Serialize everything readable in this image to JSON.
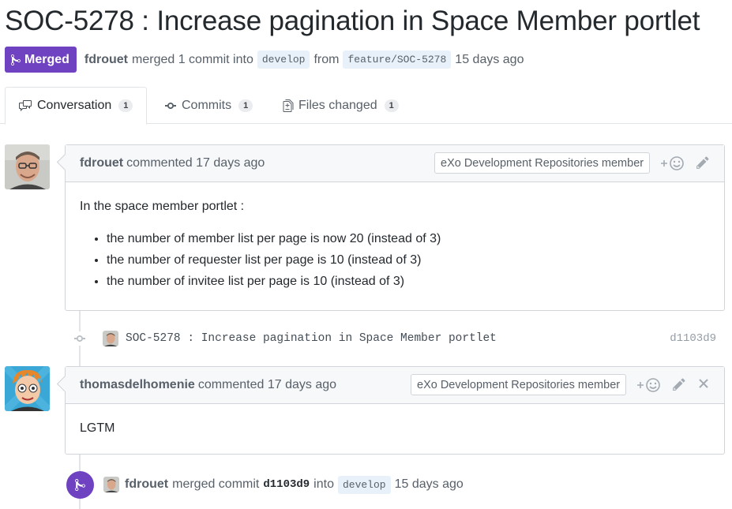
{
  "pr": {
    "title": "SOC-5278 : Increase pagination in Space Member portlet",
    "state": "Merged",
    "author": "fdrouet",
    "merged_text": "merged 1 commit into",
    "base_branch": "develop",
    "from_text": "from",
    "head_branch": "feature/SOC-5278",
    "time": "15 days ago"
  },
  "tabs": [
    {
      "label": "Conversation",
      "count": "1",
      "icon": "comment-discussion-icon",
      "selected": true
    },
    {
      "label": "Commits",
      "count": "1",
      "icon": "git-commit-icon",
      "selected": false
    },
    {
      "label": "Files changed",
      "count": "1",
      "icon": "file-diff-icon",
      "selected": false
    }
  ],
  "comments": [
    {
      "author": "fdrouet",
      "action": "commented 17 days ago",
      "role": "eXo Development Repositories member",
      "intro": "In the space member portlet :",
      "items": [
        "the number of member list per page is now 20 (instead of 3)",
        "the number of requester list per page is 10 (instead of 3)",
        "the number of invitee list per page is 10 (instead of 3)"
      ]
    },
    {
      "author": "thomasdelhomenie",
      "action": "commented 17 days ago",
      "role": "eXo Development Repositories member",
      "text": "LGTM"
    }
  ],
  "commit": {
    "message": "SOC-5278 : Increase pagination in Space Member portlet",
    "sha": "d1103d9"
  },
  "merge_event": {
    "author": "fdrouet",
    "text": "merged commit",
    "sha": "d1103d9",
    "into": "into",
    "branch": "develop",
    "time": "15 days ago"
  },
  "colors": {
    "merged": "#6f42c1",
    "branch_bg": "#e8f1fa",
    "border": "#d1d5da"
  },
  "icons": {
    "add_reaction": "smiley-icon",
    "edit": "pencil-icon",
    "delete": "close-icon"
  }
}
